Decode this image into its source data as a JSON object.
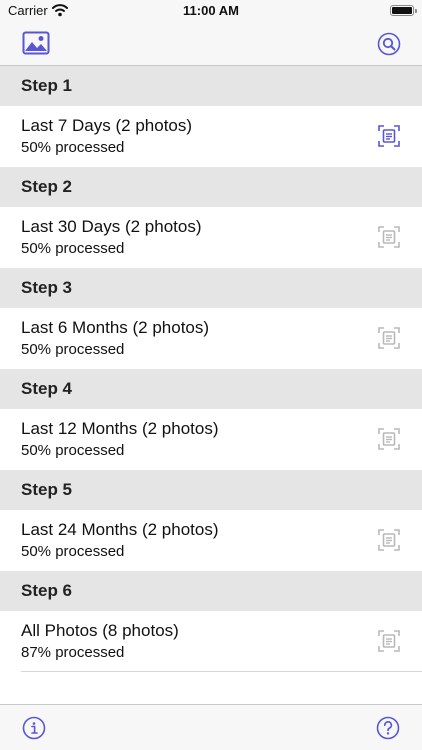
{
  "status_bar": {
    "carrier": "Carrier",
    "time": "11:00 AM",
    "wifi_icon": "wifi-icon",
    "battery_icon": "battery-icon"
  },
  "nav_bar": {
    "left_icon": "photo-library-icon",
    "right_icon": "search-icon"
  },
  "colors": {
    "accent": "#5856d6",
    "inactive_icon": "#b9b9b9",
    "section_bg": "#e5e5e5",
    "bar_bg": "#f7f7f7"
  },
  "sections": [
    {
      "header": "Step 1",
      "title": "Last 7 Days (2 photos)",
      "subtitle": "50% processed",
      "progress": 0.5,
      "icon": "scan-document-icon",
      "icon_active": true
    },
    {
      "header": "Step 2",
      "title": "Last 30 Days (2 photos)",
      "subtitle": "50% processed",
      "progress": 0.5,
      "icon": "scan-document-icon",
      "icon_active": false
    },
    {
      "header": "Step 3",
      "title": "Last 6 Months (2 photos)",
      "subtitle": "50% processed",
      "progress": 0.5,
      "icon": "scan-document-icon",
      "icon_active": false
    },
    {
      "header": "Step 4",
      "title": "Last 12 Months (2 photos)",
      "subtitle": "50% processed",
      "progress": 0.5,
      "icon": "scan-document-icon",
      "icon_active": false
    },
    {
      "header": "Step 5",
      "title": "Last 24 Months (2 photos)",
      "subtitle": "50% processed",
      "progress": 0.5,
      "icon": "scan-document-icon",
      "icon_active": false
    },
    {
      "header": "Step 6",
      "title": "All Photos (8 photos)",
      "subtitle": "87% processed",
      "progress": 0.87,
      "icon": "scan-document-icon",
      "icon_active": false
    }
  ],
  "tool_bar": {
    "left_icon": "info-icon",
    "right_icon": "help-icon"
  }
}
